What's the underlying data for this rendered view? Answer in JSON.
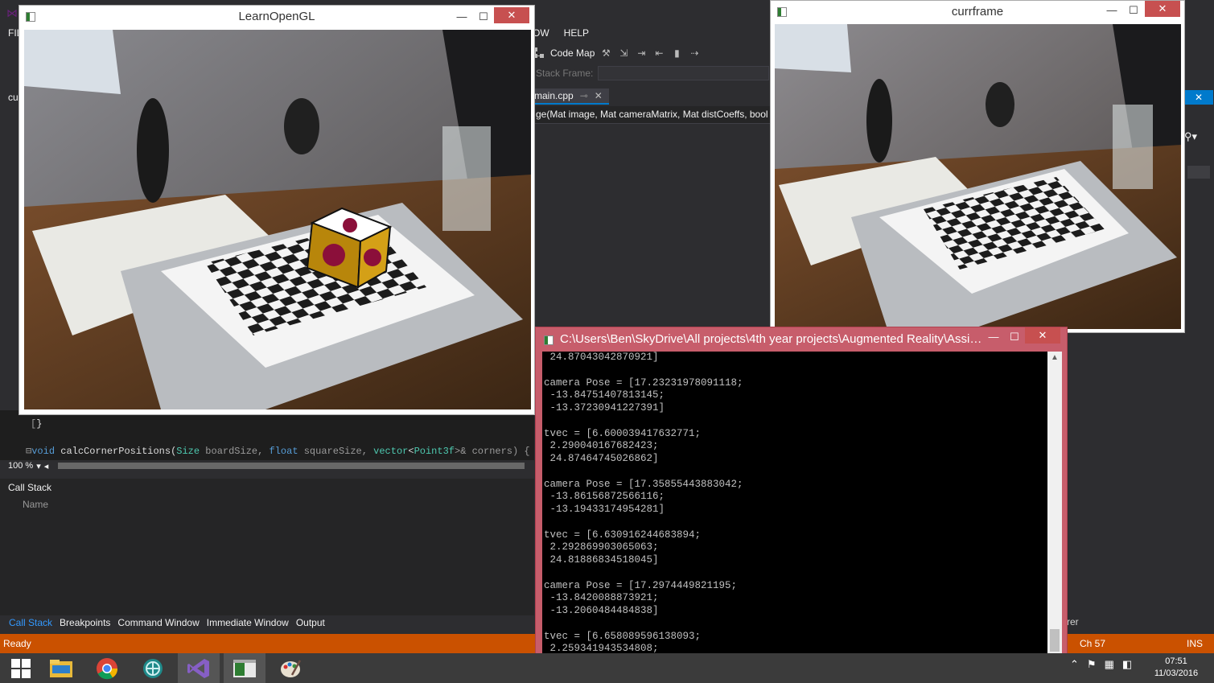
{
  "vs": {
    "file_menu": "FIL",
    "menu": [
      "OW",
      "HELP"
    ],
    "toolbar": {
      "code_map": "Code Map"
    },
    "stack_frame_label": "Stack Frame:",
    "doc_tab": "main.cpp",
    "signature": "ge(Mat image, Mat cameraMatrix, Mat distCoeffs, bool",
    "left_fragment": "cu",
    "code": {
      "brace": "}",
      "kw_void": "void",
      "func": "calcCornerPositions(",
      "t_size": "Size",
      "p_board": " boardSize, ",
      "kw_float": "float",
      "p_square": " squareSize, ",
      "t_vector": "vector",
      "t_point": "Point3f",
      "p_corners": "&gt; corners) {"
    },
    "zoom": "100 %",
    "callstack": {
      "title": "Call Stack",
      "column_name": "Name"
    },
    "bottom_tabs": [
      "Call Stack",
      "Breakpoints",
      "Command Window",
      "Immediate Window",
      "Output"
    ],
    "right_fragment": "rer",
    "status": {
      "ready": "Ready",
      "ch": "Ch 57",
      "ins": "INS"
    }
  },
  "windows": {
    "learnopengl": {
      "title": "LearnOpenGL"
    },
    "currframe": {
      "title": "currframe"
    },
    "console": {
      "title": "C:\\Users\\Ben\\SkyDrive\\All projects\\4th year projects\\Augmented Reality\\Assig...",
      "lines": [
        " 24.87043042870921]",
        "",
        "camera Pose = [17.23231978091118;",
        " -13.84751407813145;",
        " -13.37230941227391]",
        "",
        "tvec = [6.600039417632771;",
        " 2.290040167682423;",
        " 24.87464745026862]",
        "",
        "camera Pose = [17.35855443883042;",
        " -13.86156872566116;",
        " -13.19433174954281]",
        "",
        "tvec = [6.630916244683894;",
        " 2.292869903065063;",
        " 24.81886834518045]",
        "",
        "camera Pose = [17.2974449821195;",
        " -13.8420088873921;",
        " -13.2060484484838]",
        "",
        "tvec = [6.658089596138093;",
        " 2.259341943534808;"
      ]
    }
  },
  "window_controls": {
    "minimize": "—",
    "maximize": "☐",
    "close": "✕"
  },
  "taskbar": {
    "apps": [
      "start-icon",
      "file-explorer-icon",
      "chrome-icon",
      "network-app-icon",
      "visual-studio-icon",
      "console-app-icon",
      "paint-icon"
    ],
    "clock_time": "07:51",
    "clock_date": "11/03/2016"
  },
  "colors": {
    "vs_dark": "#2d2d30",
    "status_orange": "#ca5100",
    "console_border": "#c75d6b",
    "accent_blue": "#007acc"
  }
}
